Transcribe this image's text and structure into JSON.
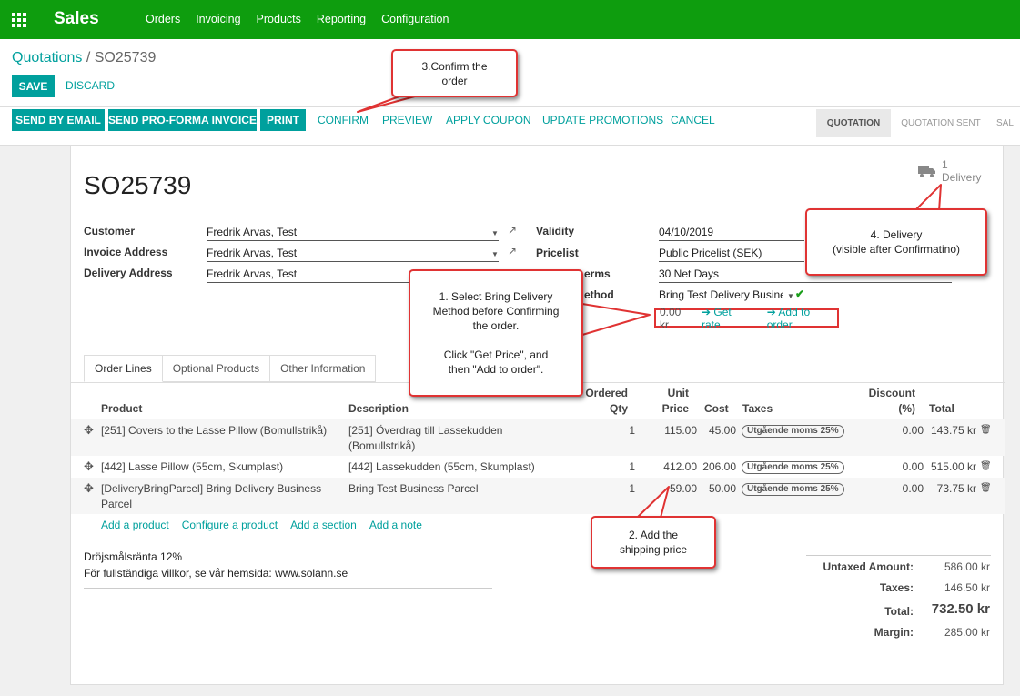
{
  "topbar": {
    "app_name": "Sales",
    "menu": [
      "Orders",
      "Invoicing",
      "Products",
      "Reporting",
      "Configuration"
    ],
    "color": "#0e9d0e"
  },
  "breadcrumb": {
    "parent": "Quotations",
    "separator": "/",
    "current": "SO25739"
  },
  "buttons": {
    "save": "SAVE",
    "discard": "DISCARD",
    "send_email": "SEND BY EMAIL",
    "send_proforma": "SEND PRO-FORMA INVOICE",
    "print": "PRINT",
    "confirm": "CONFIRM",
    "preview": "PREVIEW",
    "apply_coupon": "APPLY COUPON",
    "update_promotions": "UPDATE PROMOTIONS",
    "cancel": "CANCEL"
  },
  "status": {
    "stages": [
      "QUOTATION",
      "QUOTATION SENT",
      "SAL"
    ],
    "active": "QUOTATION"
  },
  "smart_button": {
    "count": "1",
    "label": "Delivery",
    "icon": "truck-icon"
  },
  "record": {
    "name": "SO25739",
    "customer_label": "Customer",
    "customer": "Fredrik Arvas, Test",
    "invoice_address_label": "Invoice Address",
    "invoice_address": "Fredrik Arvas, Test",
    "delivery_address_label": "Delivery Address",
    "delivery_address": "Fredrik Arvas, Test",
    "validity_label": "Validity",
    "validity": "04/10/2019",
    "pricelist_label": "Pricelist",
    "pricelist": "Public Pricelist (SEK)",
    "payment_terms_label_visible": "erms",
    "payment_terms": "30 Net Days",
    "delivery_method_label_visible": "ethod",
    "delivery_method": "Bring Test Delivery Busine:",
    "shipping_amount": "0.00 kr",
    "get_rate": "Get rate",
    "add_to_order": "Add to order"
  },
  "tabs": [
    "Order Lines",
    "Optional Products",
    "Other Information"
  ],
  "table": {
    "headers": {
      "product": "Product",
      "description": "Description",
      "ordered_qty_1": "Ordered",
      "ordered_qty_2": "Qty",
      "unit_price_1": "Unit",
      "unit_price_2": "Price",
      "cost": "Cost",
      "taxes": "Taxes",
      "discount_1": "Discount",
      "discount_2": "(%)",
      "total": "Total"
    },
    "rows": [
      {
        "product": "[251] Covers to the Lasse Pillow (Bomullstrikå)",
        "description": "[251] Överdrag till Lassekudden (Bomullstrikå)",
        "qty": "1",
        "unit_price": "115.00",
        "cost": "45.00",
        "tax": "Utgående moms 25%",
        "discount": "0.00",
        "total": "143.75 kr"
      },
      {
        "product": "[442] Lasse Pillow (55cm, Skumplast)",
        "description": "[442] Lassekudden (55cm, Skumplast)",
        "qty": "1",
        "unit_price": "412.00",
        "cost": "206.00",
        "tax": "Utgående moms 25%",
        "discount": "0.00",
        "total": "515.00 kr"
      },
      {
        "product": "[DeliveryBringParcel] Bring Delivery Business Parcel",
        "description": "Bring Test Business Parcel",
        "qty": "1",
        "unit_price": "59.00",
        "cost": "50.00",
        "tax": "Utgående moms 25%",
        "discount": "0.00",
        "total": "73.75 kr"
      }
    ]
  },
  "add_links": [
    "Add a product",
    "Configure a product",
    "Add a section",
    "Add a note"
  ],
  "note": {
    "line1": "Dröjsmålsränta 12%",
    "line2": "För fullständiga villkor, se vår hemsida: www.solann.se"
  },
  "totals": {
    "untaxed_label": "Untaxed Amount:",
    "untaxed": "586.00 kr",
    "taxes_label": "Taxes:",
    "taxes": "146.50 kr",
    "total_label": "Total:",
    "total": "732.50 kr",
    "margin_label": "Margin:",
    "margin": "285.00 kr"
  },
  "callouts": {
    "confirm": "3.Confirm the\norder",
    "delivery": "4. Delivery\n(visible after Confirmatino)",
    "select_method": "1. Select Bring Delivery\nMethod before Confirming\nthe order.\n\nClick \"Get Price\", and\nthen \"Add to order\".",
    "shipping": "2. Add the\nshipping price"
  },
  "colors": {
    "accent": "#00a09d",
    "callout_border": "#e03333",
    "link": "#00a09d"
  }
}
